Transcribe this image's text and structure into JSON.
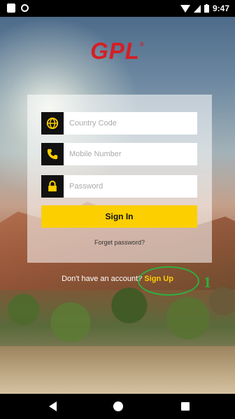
{
  "status_bar": {
    "time": "9:47",
    "icons": [
      "notification-icon",
      "sync-icon",
      "wifi-icon",
      "signal-icon",
      "battery-icon"
    ]
  },
  "logo": {
    "text": "GPL",
    "mark": "®"
  },
  "login": {
    "country_code": {
      "placeholder": "Country Code",
      "icon": "globe-icon",
      "value": ""
    },
    "mobile": {
      "placeholder": "Mobile Number",
      "icon": "phone-icon",
      "value": ""
    },
    "password": {
      "placeholder": "Password",
      "icon": "lock-icon",
      "value": ""
    },
    "sign_in_label": "Sign In",
    "forgot_label": "Forget password?"
  },
  "signup_prompt": {
    "text": "Don't have an account?",
    "link": "Sign Up"
  },
  "annotation": {
    "number": "1"
  },
  "nav": [
    "back-icon",
    "home-icon",
    "recents-icon"
  ],
  "colors": {
    "accent": "#fccf00",
    "brand": "#d61e24",
    "annotation": "#2fae3d"
  }
}
